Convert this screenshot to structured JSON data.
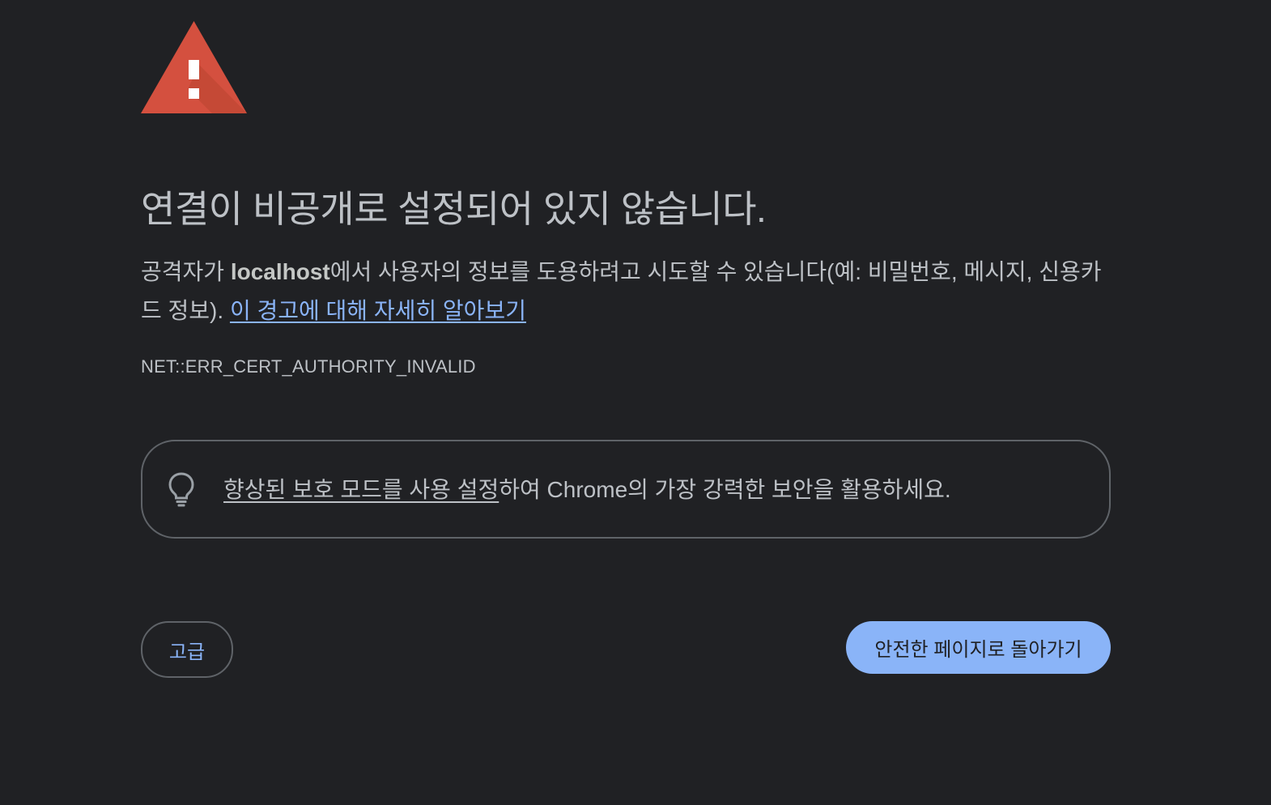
{
  "interstitial": {
    "icon": "warning-triangle-icon",
    "heading": "연결이 비공개로 설정되어 있지 않습니다.",
    "explanation": {
      "prefix": "공격자가 ",
      "host": "localhost",
      "suffix": "에서 사용자의 정보를 도용하려고 시도할 수 있습니다(예: 비밀번호, 메시지, 신용카드 정보). ",
      "learn_more_link": "이 경고에 대해 자세히 알아보기"
    },
    "error_code": "NET::ERR_CERT_AUTHORITY_INVALID",
    "enhanced_protection": {
      "icon": "lightbulb-icon",
      "link_text": "향상된 보호 모드를 사용 설정",
      "rest_text": "하여 Chrome의 가장 강력한 보안을 활용하세요."
    },
    "buttons": {
      "advanced_label": "고급",
      "back_to_safety_label": "안전한 페이지로 돌아가기"
    }
  },
  "colors": {
    "background": "#202124",
    "text": "#bdc1c6",
    "link": "#8ab4f8",
    "warning_red": "#d4503f",
    "primary_button": "#8ab4f8",
    "border": "#5f6368"
  }
}
